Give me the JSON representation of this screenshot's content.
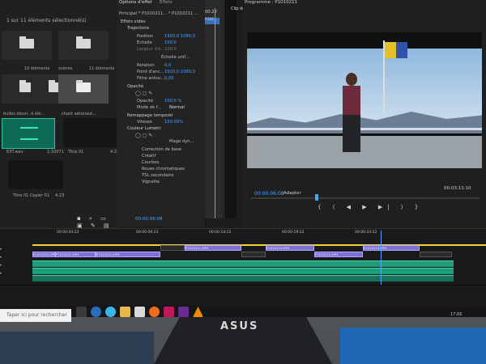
{
  "brand": {
    "logo": "ASUS"
  },
  "project_panel": {
    "header": "1 sur 11 éléments sélectionné(s)",
    "items": [
      {
        "label": "",
        "count": "",
        "kind": "folder"
      },
      {
        "label": "",
        "count": "",
        "kind": "folder"
      },
      {
        "label": "",
        "count": "10 éléments",
        "kind": "folder"
      },
      {
        "label": "scènes",
        "count": "11 éléments",
        "kind": "folder"
      },
      {
        "label": "",
        "count": "",
        "kind": "folder"
      },
      {
        "label": "",
        "count": "",
        "kind": "folder"
      },
      {
        "label": "bulles décor...",
        "count": "4 élé...",
        "kind": "folder"
      },
      {
        "label": "chant aéronaut...",
        "count": "",
        "kind": "folder-selected"
      },
      {
        "label": "",
        "count": "",
        "kind": "folder"
      },
      {
        "label": "EXT.wav",
        "count": "1:10071",
        "kind": "audio"
      },
      {
        "label": "Titre 01",
        "count": "4:23",
        "kind": "title"
      },
      {
        "label": "",
        "count": "",
        "kind": "video"
      },
      {
        "label": "Titre 01 Copier 01",
        "count": "4:23",
        "kind": "title"
      }
    ]
  },
  "effect_controls": {
    "tabs": [
      "Options d'effet",
      "Effets",
      "Source : P1010211..."
    ],
    "source_line": "Principal * P1010211...  * P1010211 ...",
    "tc_head": "00:22",
    "rows": [
      {
        "label": "Effets vidéo",
        "value": ""
      },
      {
        "label": "Trajectoire",
        "value": ""
      },
      {
        "label": "Position",
        "value": "1920,0    1080,0"
      },
      {
        "label": "Échelle",
        "value": "100,0"
      },
      {
        "label": "Largeur d'é...",
        "value": "100,0"
      },
      {
        "label": "",
        "value": "Échelle unif..."
      },
      {
        "label": "Rotation",
        "value": "0,0"
      },
      {
        "label": "Point d'anc...",
        "value": "1920,0    1080,0"
      },
      {
        "label": "Filtre antisc...",
        "value": "0,00"
      },
      {
        "label": "Opacité",
        "value": ""
      },
      {
        "label": "Opacité",
        "value": "100,0 %"
      },
      {
        "label": "Mode de f...",
        "value": "Normal"
      },
      {
        "label": "Remappage temporel",
        "value": ""
      },
      {
        "label": "Vitesse",
        "value": "100,00%"
      },
      {
        "label": "Couleur Lumetri",
        "value": ""
      },
      {
        "label": "",
        "value": "Mage dyn..."
      },
      {
        "label": "Correction de base",
        "value": ""
      },
      {
        "label": "Créatif",
        "value": ""
      },
      {
        "label": "Courbes",
        "value": ""
      },
      {
        "label": "Roues chromatiques",
        "value": ""
      },
      {
        "label": "TSL secondaire",
        "value": ""
      },
      {
        "label": "Vignette",
        "value": ""
      }
    ],
    "timecode": "00:00:06:08",
    "clip_label": "P101..."
  },
  "program_monitor": {
    "header": "Programme : P1010211",
    "clip_label": "Clip de",
    "timecode_left": "00:00:06:08",
    "fit": "Adapter",
    "timecode_right": "00:03:11:10",
    "transport": "{ ⟨ ◀ ▶ ▶| ⟩ }"
  },
  "timeline": {
    "ruler": [
      "00:00:04:23",
      "00:00:09:23",
      "00:00:14:22",
      "00:00:19:22",
      "00:00:24:22"
    ],
    "clips": [
      {
        "label": "P1010202.MP4",
        "dark": false
      },
      {
        "label": "P1010207.MP4",
        "dark": false
      },
      {
        "label": "P1010201.MP4",
        "dark": false
      },
      {
        "label": "",
        "dark": true
      },
      {
        "label": "P1010211.MP4",
        "dark": false
      },
      {
        "label": "",
        "dark": true
      },
      {
        "label": "P1010215.MP4",
        "dark": false
      },
      {
        "label": "P1010210.MP4",
        "dark": false
      },
      {
        "label": "P1010214.MP4",
        "dark": false
      },
      {
        "label": "",
        "dark": true
      }
    ]
  },
  "taskbar": {
    "search_text": "Taper ici pour rechercher",
    "icons": [
      "cortana-icon",
      "task-view-icon",
      "edge-icon",
      "file-explorer-icon",
      "store-icon",
      "firefox-icon",
      "app-icon",
      "premiere-icon",
      "vlc-icon"
    ],
    "tray": "17:05"
  },
  "colors": {
    "accent": "#4aa3ff",
    "video_clip": "#7c6fd6",
    "audio_track": "#1f9c7a",
    "work_area": "#f0d23c"
  }
}
